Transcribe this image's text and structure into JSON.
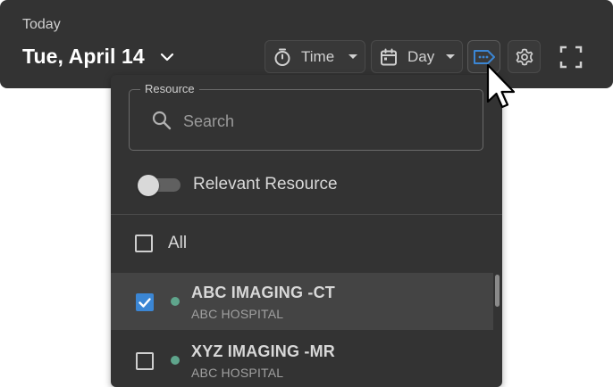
{
  "header": {
    "today_label": "Today",
    "date": "Tue, April 14",
    "time_select": {
      "value": "Time",
      "icon": "stopwatch-icon"
    },
    "view_select": {
      "value": "Day",
      "icon": "calendar-icon"
    },
    "resource_button_icon": "resource-tag-icon",
    "settings_icon": "gear-icon",
    "fullscreen_icon": "fullscreen-icon"
  },
  "resource_panel": {
    "search": {
      "legend": "Resource",
      "placeholder": "Search",
      "value": ""
    },
    "relevant_toggle": {
      "label": "Relevant Resource",
      "on": false
    },
    "all_option": {
      "label": "All",
      "checked": false
    },
    "resources": [
      {
        "name": "ABC IMAGING -CT",
        "facility": "ABC HOSPITAL",
        "checked": true,
        "status_color": "#5fa58c"
      },
      {
        "name": "XYZ IMAGING -MR",
        "facility": "ABC HOSPITAL",
        "checked": false,
        "status_color": "#5fa58c"
      }
    ]
  },
  "colors": {
    "accent": "#3b86d4",
    "surface": "#333333",
    "status_dot": "#5fa58c"
  }
}
